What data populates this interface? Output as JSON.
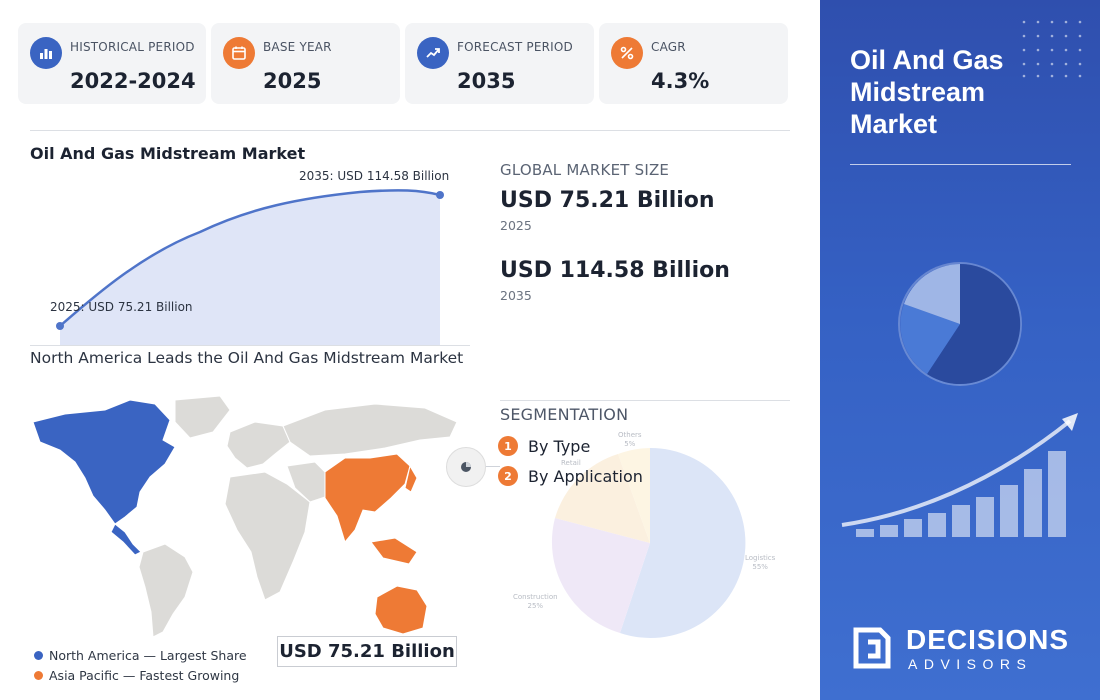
{
  "stats": [
    {
      "label": "HISTORICAL PERIOD",
      "value": "2022-2024",
      "icon": "bar-chart-icon",
      "color": "#3a64c2"
    },
    {
      "label": "BASE YEAR",
      "value": "2025",
      "icon": "calendar-icon",
      "color": "#ee7a35"
    },
    {
      "label": "FORECAST PERIOD",
      "value": "2035",
      "icon": "trend-up-icon",
      "color": "#3a64c2"
    },
    {
      "label": "CAGR",
      "value": "4.3%",
      "icon": "percent-icon",
      "color": "#ee7a35"
    }
  ],
  "trend": {
    "title": "Oil And Gas Midstream Market",
    "start_label": "2025: USD 75.21 Billion",
    "end_label": "2035: USD 114.58 Billion"
  },
  "market_size": {
    "heading": "GLOBAL MARKET SIZE",
    "current_value": "USD 75.21 Billion",
    "current_year": "2025",
    "forecast_value": "USD 114.58 Billion",
    "forecast_year": "2035"
  },
  "map": {
    "title": "North America Leads the Oil And Gas Midstream Market",
    "value_box": "USD 75.21 Billion",
    "legend": [
      {
        "label": "North America — Largest Share",
        "color": "#3a64c2"
      },
      {
        "label": "Asia Pacific — Fastest Growing",
        "color": "#ee7a35"
      }
    ]
  },
  "segmentation": {
    "heading": "SEGMENTATION",
    "items": [
      {
        "num": "1",
        "label": "By Type"
      },
      {
        "num": "2",
        "label": "By Application"
      }
    ],
    "pie_labels": [
      {
        "name": "Others",
        "pct": "5%"
      },
      {
        "name": "Retail",
        "pct": ""
      },
      {
        "name": "Logistics",
        "pct": "55%"
      },
      {
        "name": "Construction",
        "pct": "25%"
      }
    ]
  },
  "panel": {
    "title": "Oil And Gas Midstream Market",
    "brand_top": "DECISIONS",
    "brand_bottom": "ADVISORS"
  },
  "colors": {
    "accent_blue": "#3a64c2",
    "accent_orange": "#ee7a35",
    "panel_blue": "#3561c4"
  }
}
